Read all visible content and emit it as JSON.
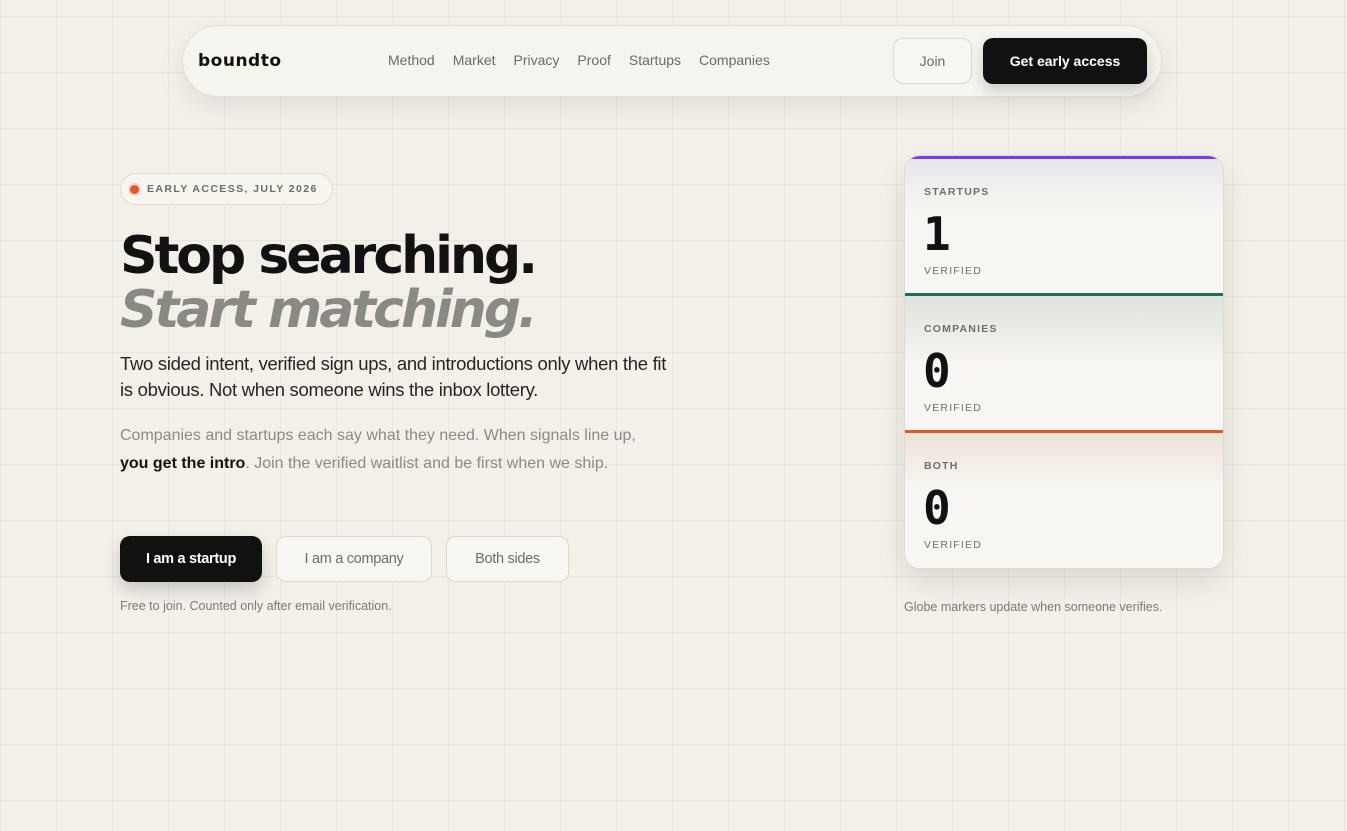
{
  "nav": {
    "brand": "boundto",
    "links": [
      "Method",
      "Market",
      "Privacy",
      "Proof",
      "Startups",
      "Companies"
    ],
    "join_label": "Join",
    "cta_label": "Get early access"
  },
  "hero": {
    "badge": "EARLY ACCESS, JULY 2026",
    "headline_1": "Stop searching.",
    "headline_2": "Start matching.",
    "lead": "Two sided intent, verified sign ups, and introductions only when the fit is obvious. Not when someone wins the inbox lottery.",
    "body_before": "Companies and startups each say what they need. When signals line up, ",
    "body_bold": "you get the intro",
    "body_after": ". Join the verified waitlist and be first when we ship.",
    "roles": [
      "I am a startup",
      "I am a company",
      "Both sides"
    ],
    "footnote": "Free to join. Counted only after email verification."
  },
  "stats": {
    "items": [
      {
        "label": "STARTUPS",
        "value": "1",
        "sub": "VERIFIED",
        "color": "#7c3aed"
      },
      {
        "label": "COMPANIES",
        "value": "0",
        "sub": "VERIFIED",
        "color": "#1f6b5c"
      },
      {
        "label": "BOTH",
        "value": "0",
        "sub": "VERIFIED",
        "color": "#e0592a"
      }
    ],
    "footnote": "Globe markers update when someone verifies."
  }
}
